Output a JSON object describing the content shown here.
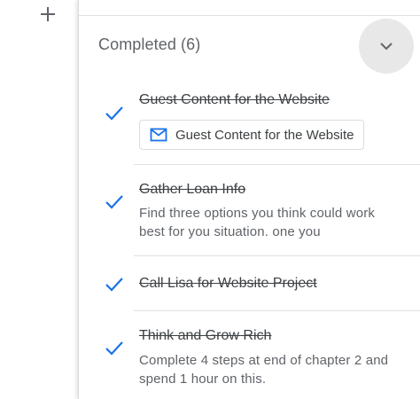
{
  "toolbar": {
    "add_icon": "plus-icon"
  },
  "completed_section": {
    "header": "Completed (6)",
    "collapse_icon": "chevron-down-icon",
    "accent_color": "#1a73e8",
    "tasks": [
      {
        "title": "Guest Content for the Website",
        "completed": true,
        "attachment": {
          "icon": "mail-icon",
          "label": "Guest Content for the Website"
        }
      },
      {
        "title": "Gather Loan Info",
        "completed": true,
        "notes": "Find three options you think could work best for you situation. one you"
      },
      {
        "title": "Call Lisa for Website Project",
        "completed": true
      },
      {
        "title": "Think and Grow Rich",
        "completed": true,
        "notes": "Complete 4 steps at end of chapter 2 and spend 1 hour on this."
      }
    ]
  }
}
